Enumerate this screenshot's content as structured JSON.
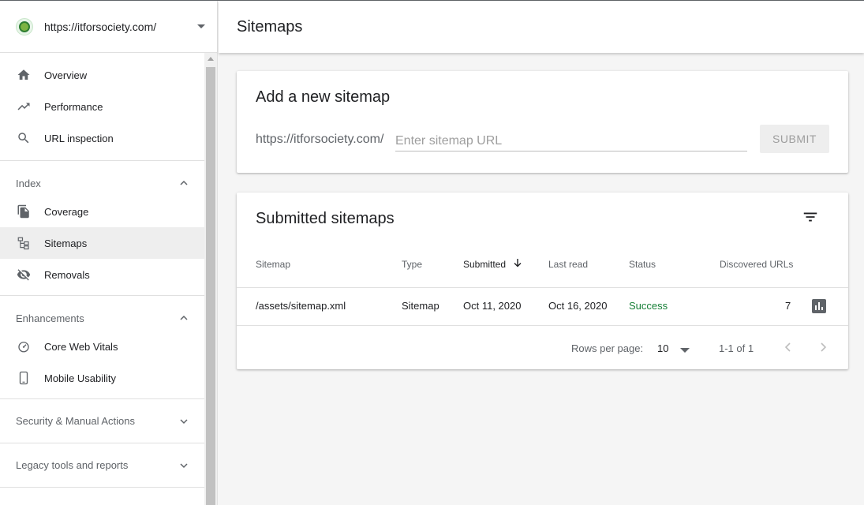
{
  "property": {
    "url": "https://itforsociety.com/"
  },
  "sidebar": {
    "top_items": [
      {
        "label": "Overview",
        "icon": "home-icon"
      },
      {
        "label": "Performance",
        "icon": "trending-up-icon"
      },
      {
        "label": "URL inspection",
        "icon": "search-icon"
      }
    ],
    "index": {
      "header": "Index",
      "items": [
        {
          "label": "Coverage",
          "icon": "copy-icon"
        },
        {
          "label": "Sitemaps",
          "icon": "sitemap-icon",
          "active": true
        },
        {
          "label": "Removals",
          "icon": "visibility-off-icon"
        }
      ]
    },
    "enhancements": {
      "header": "Enhancements",
      "items": [
        {
          "label": "Core Web Vitals",
          "icon": "speedometer-icon"
        },
        {
          "label": "Mobile Usability",
          "icon": "phone-icon"
        }
      ]
    },
    "security": {
      "header": "Security & Manual Actions"
    },
    "legacy": {
      "header": "Legacy tools and reports"
    }
  },
  "header": {
    "title": "Sitemaps"
  },
  "add_sitemap": {
    "title": "Add a new sitemap",
    "prefix": "https://itforsociety.com/",
    "placeholder": "Enter sitemap URL",
    "submit_label": "SUBMIT"
  },
  "submitted": {
    "title": "Submitted sitemaps",
    "columns": [
      "Sitemap",
      "Type",
      "Submitted",
      "Last read",
      "Status",
      "Discovered URLs"
    ],
    "rows": [
      {
        "sitemap": "/assets/sitemap.xml",
        "type": "Sitemap",
        "submitted": "Oct 11, 2020",
        "last_read": "Oct 16, 2020",
        "status": "Success",
        "discovered": "7"
      }
    ],
    "footer": {
      "rows_per_page_label": "Rows per page:",
      "rows_per_page_value": "10",
      "range": "1-1 of 1"
    }
  },
  "colors": {
    "success": "#188038",
    "active_bg": "#eeeeee",
    "icon": "#5f6368"
  }
}
